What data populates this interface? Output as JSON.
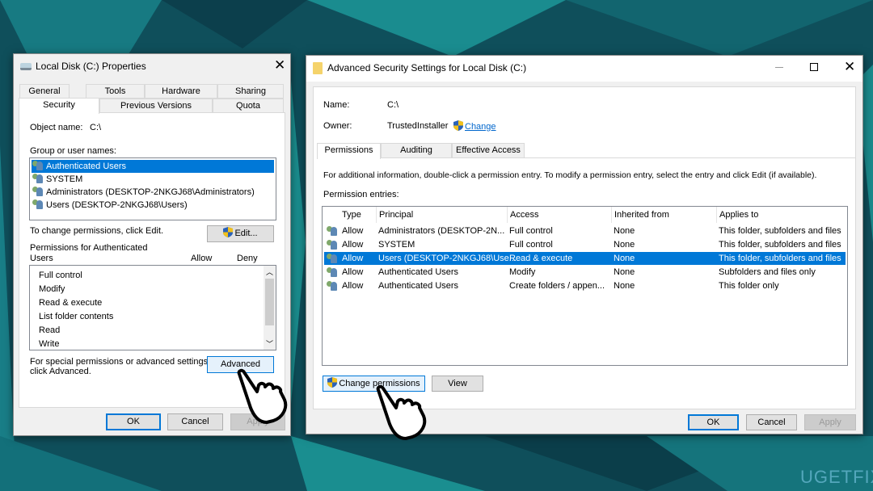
{
  "colors": {
    "accent": "#0078d7",
    "selection": "#0078d7",
    "link": "#0066cc",
    "background": "#0e4a56"
  },
  "properties": {
    "title": "Local Disk (C:) Properties",
    "tabs_row1": [
      "General",
      "Tools",
      "Hardware",
      "Sharing"
    ],
    "tabs_row2": [
      "Security",
      "Previous Versions",
      "Quota"
    ],
    "selected_tab": "Security",
    "object_name_label": "Object name:",
    "object_name_value": "C:\\",
    "group_label": "Group or user names:",
    "groups": [
      "Authenticated Users",
      "SYSTEM",
      "Administrators (DESKTOP-2NKGJ68\\Administrators)",
      "Users (DESKTOP-2NKGJ68\\Users)"
    ],
    "selected_group": "Authenticated Users",
    "edit_hint": "To change permissions, click Edit.",
    "edit_button": "Edit...",
    "perm_label_1": "Permissions for Authenticated",
    "perm_label_2": "Users",
    "allow_header": "Allow",
    "deny_header": "Deny",
    "permissions": [
      "Full control",
      "Modify",
      "Read & execute",
      "List folder contents",
      "Read",
      "Write"
    ],
    "advanced_hint_1": "For special permissions or advanced settings,",
    "advanced_hint_2": "click Advanced.",
    "advanced_button": "Advanced",
    "ok": "OK",
    "cancel": "Cancel",
    "apply": "Apply"
  },
  "advanced": {
    "title": "Advanced Security Settings for Local Disk (C:)",
    "name_label": "Name:",
    "name_value": "C:\\",
    "owner_label": "Owner:",
    "owner_value": "TrustedInstaller",
    "change_link": "Change",
    "tabs": [
      "Permissions",
      "Auditing",
      "Effective Access"
    ],
    "selected_tab": "Permissions",
    "info": "For additional information, double-click a permission entry. To modify a permission entry, select the entry and click Edit (if available).",
    "entries_label": "Permission entries:",
    "columns": [
      "Type",
      "Principal",
      "Access",
      "Inherited from",
      "Applies to"
    ],
    "rows": [
      [
        "Allow",
        "Administrators (DESKTOP-2N...",
        "Full control",
        "None",
        "This folder, subfolders and files"
      ],
      [
        "Allow",
        "SYSTEM",
        "Full control",
        "None",
        "This folder, subfolders and files"
      ],
      [
        "Allow",
        "Users (DESKTOP-2NKGJ68\\Use...",
        "Read & execute",
        "None",
        "This folder, subfolders and files"
      ],
      [
        "Allow",
        "Authenticated Users",
        "Modify",
        "None",
        "Subfolders and files only"
      ],
      [
        "Allow",
        "Authenticated Users",
        "Create folders / appen...",
        "None",
        "This folder only"
      ]
    ],
    "selected_row": 2,
    "change_permissions_button": "Change permissions",
    "view_button": "View",
    "ok": "OK",
    "cancel": "Cancel",
    "apply": "Apply"
  },
  "watermark": "UGETFIX"
}
